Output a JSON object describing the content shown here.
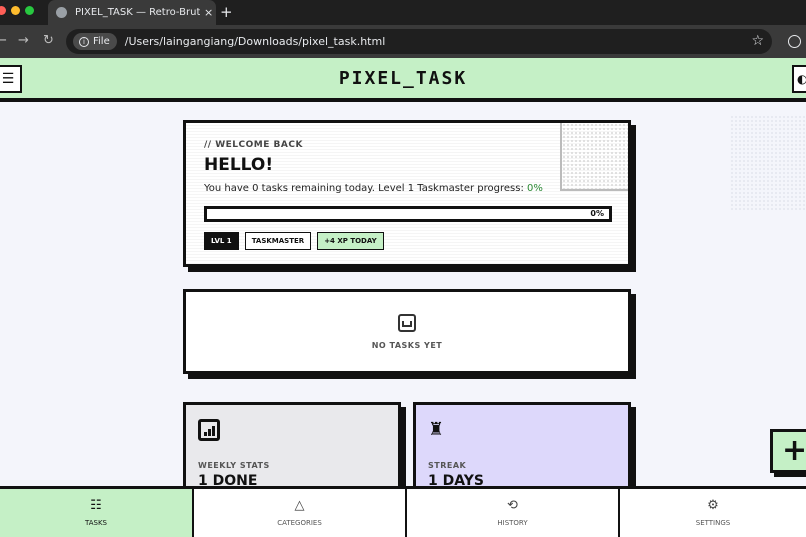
{
  "browser": {
    "tab_title": "PIXEL_TASK — Retro-Brutalis",
    "tab_close": "×",
    "new_tab": "+",
    "chip_label": "File",
    "url": "/Users/laingangiang/Downloads/pixel_task.html",
    "back": "←",
    "forward": "→",
    "reload": "↻",
    "star": "☆",
    "info": "i"
  },
  "header": {
    "title": "PIXEL_TASK",
    "menu_icon": "☰",
    "profile_icon": "◐"
  },
  "welcome": {
    "eyebrow": "// WELCOME BACK",
    "heading": "HELLO!",
    "message_prefix": "You have 0 tasks remaining today. Level 1 Taskmaster progress: ",
    "progress_value": "0%",
    "progress_fraction": 0,
    "progress_label": "0%",
    "badges": [
      "LVL 1",
      "TASKMASTER",
      "+4 XP TODAY"
    ]
  },
  "empty_state": {
    "label": "NO TASKS YET"
  },
  "stats": {
    "weekly": {
      "label": "WEEKLY STATS",
      "value": "1 DONE"
    },
    "streak": {
      "label": "STREAK",
      "value": "1 DAYS",
      "icon": "♜"
    }
  },
  "fab": {
    "label": "+"
  },
  "nav": [
    {
      "label": "TASKS",
      "icon": "☷",
      "active": true
    },
    {
      "label": "CATEGORIES",
      "icon": "△",
      "active": false
    },
    {
      "label": "HISTORY",
      "icon": "⟲",
      "active": false
    },
    {
      "label": "SETTINGS",
      "icon": "⚙",
      "active": false
    }
  ],
  "colors": {
    "accent_green": "#c5f0c6",
    "streak_purple": "#ddd8fb",
    "ink": "#111111"
  }
}
